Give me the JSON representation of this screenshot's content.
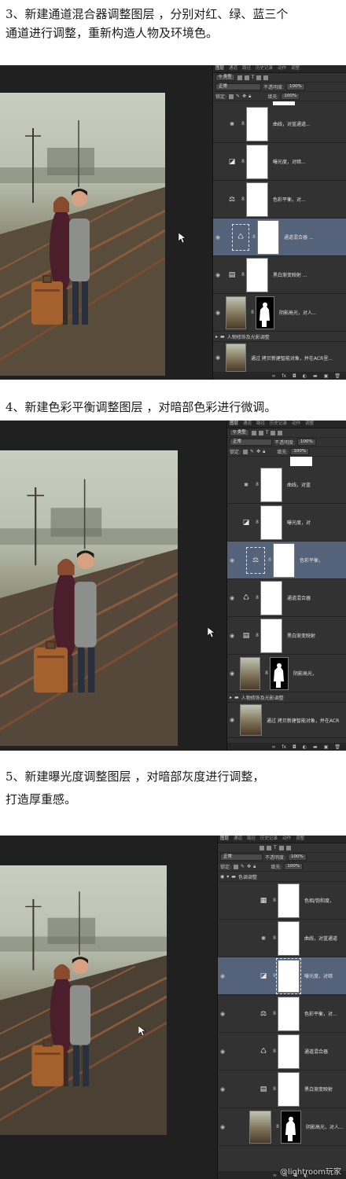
{
  "steps": [
    {
      "caption_line1": "3、新建通道混合器调整图层 ，分别对红、绿、蓝三个",
      "caption_line2": "通道进行调整，重新构造人物及环境色。",
      "panel": {
        "tabs": [
          "图层",
          "通道",
          "路径",
          "历史记录",
          "动作",
          "调整"
        ],
        "filter_label": "类型",
        "blend_mode": "正常",
        "opacity_label": "不透明度:",
        "opacity_value": "100%",
        "lock_label": "锁定:",
        "fill_label": "填充:",
        "fill_value": "100%",
        "layers": [
          {
            "icon": "curves-icon",
            "glyph": "⨳",
            "name": "曲线，对蓝通道...",
            "selected": false
          },
          {
            "icon": "exposure-icon",
            "glyph": "◪",
            "name": "曝光度，对暗...",
            "selected": false
          },
          {
            "icon": "color-balance-icon",
            "glyph": "⚖",
            "name": "色彩平衡，对...",
            "selected": false
          },
          {
            "icon": "channel-mixer-icon",
            "glyph": "♺",
            "name": "通道混合器 ...",
            "selected": true
          },
          {
            "icon": "black-white-icon",
            "glyph": "▤",
            "name": "黑白渐变映射 ...",
            "selected": false
          },
          {
            "icon": "image-icon",
            "glyph": "",
            "name": "阴影高光，对人...",
            "selected": false
          }
        ],
        "group_name": "人物修饰及光影调整",
        "smart_layer_name": "通过 拷贝新建智能对象，并在ACR里..."
      }
    },
    {
      "caption_line1": "4、新建色彩平衡调整图层 ，对暗部色彩进行微调。",
      "panel": {
        "tabs": [
          "图层",
          "通道",
          "路径",
          "历史记录",
          "动作",
          "调整"
        ],
        "filter_label": "类型",
        "blend_mode": "正常",
        "opacity_label": "不透明度:",
        "opacity_value": "100%",
        "lock_label": "锁定:",
        "fill_label": "填充:",
        "fill_value": "100%",
        "layers": [
          {
            "icon": "curves-icon",
            "glyph": "⨳",
            "name": "曲线，对蓝",
            "selected": false
          },
          {
            "icon": "exposure-icon",
            "glyph": "◪",
            "name": "曝光度，对",
            "selected": false
          },
          {
            "icon": "color-balance-icon",
            "glyph": "⚖",
            "name": "色彩平衡，",
            "selected": true
          },
          {
            "icon": "channel-mixer-icon",
            "glyph": "♺",
            "name": "通道混合器",
            "selected": false
          },
          {
            "icon": "black-white-icon",
            "glyph": "▤",
            "name": "黑白渐变映射",
            "selected": false
          },
          {
            "icon": "image-icon",
            "glyph": "",
            "name": "阴影高光，",
            "selected": false
          }
        ],
        "group_name": "人物修饰及光影调整",
        "smart_layer_name": "通过 拷贝新建智能对象，并在ACR"
      }
    },
    {
      "caption_line1": "5、新建曝光度调整图层 ，对暗部灰度进行调整，",
      "caption_line2": "打造厚重感。",
      "panel": {
        "tabs": [
          "图层",
          "通道",
          "路径",
          "历史记录",
          "动作",
          "调整"
        ],
        "blend_mode": "正常",
        "opacity_label": "不透明度:",
        "opacity_value": "100%",
        "lock_label": "锁定:",
        "fill_label": "填充:",
        "fill_value": "100%",
        "group_name": "色调调整",
        "layers": [
          {
            "icon": "hue-saturation-icon",
            "glyph": "▦",
            "name": "色相/饱和度，",
            "selected": false
          },
          {
            "icon": "curves-icon",
            "glyph": "⨳",
            "name": "曲线，对蓝通道",
            "selected": false
          },
          {
            "icon": "exposure-icon",
            "glyph": "◪",
            "name": "曝光度，对暗",
            "selected": true
          },
          {
            "icon": "color-balance-icon",
            "glyph": "⚖",
            "name": "色彩平衡，对...",
            "selected": false
          },
          {
            "icon": "channel-mixer-icon",
            "glyph": "♺",
            "name": "通道混合器",
            "selected": false
          },
          {
            "icon": "black-white-icon",
            "glyph": "▤",
            "name": "黑白渐变映射",
            "selected": false
          },
          {
            "icon": "image-icon",
            "glyph": "",
            "name": "阴影高光，对人...",
            "selected": false
          }
        ]
      },
      "watermark": "@lightroom玩家"
    }
  ],
  "colors": {
    "page_bg": "#ffffff",
    "workspace_bg": "#202020",
    "panel_bg": "#323232",
    "selected_layer": "#54627a"
  }
}
